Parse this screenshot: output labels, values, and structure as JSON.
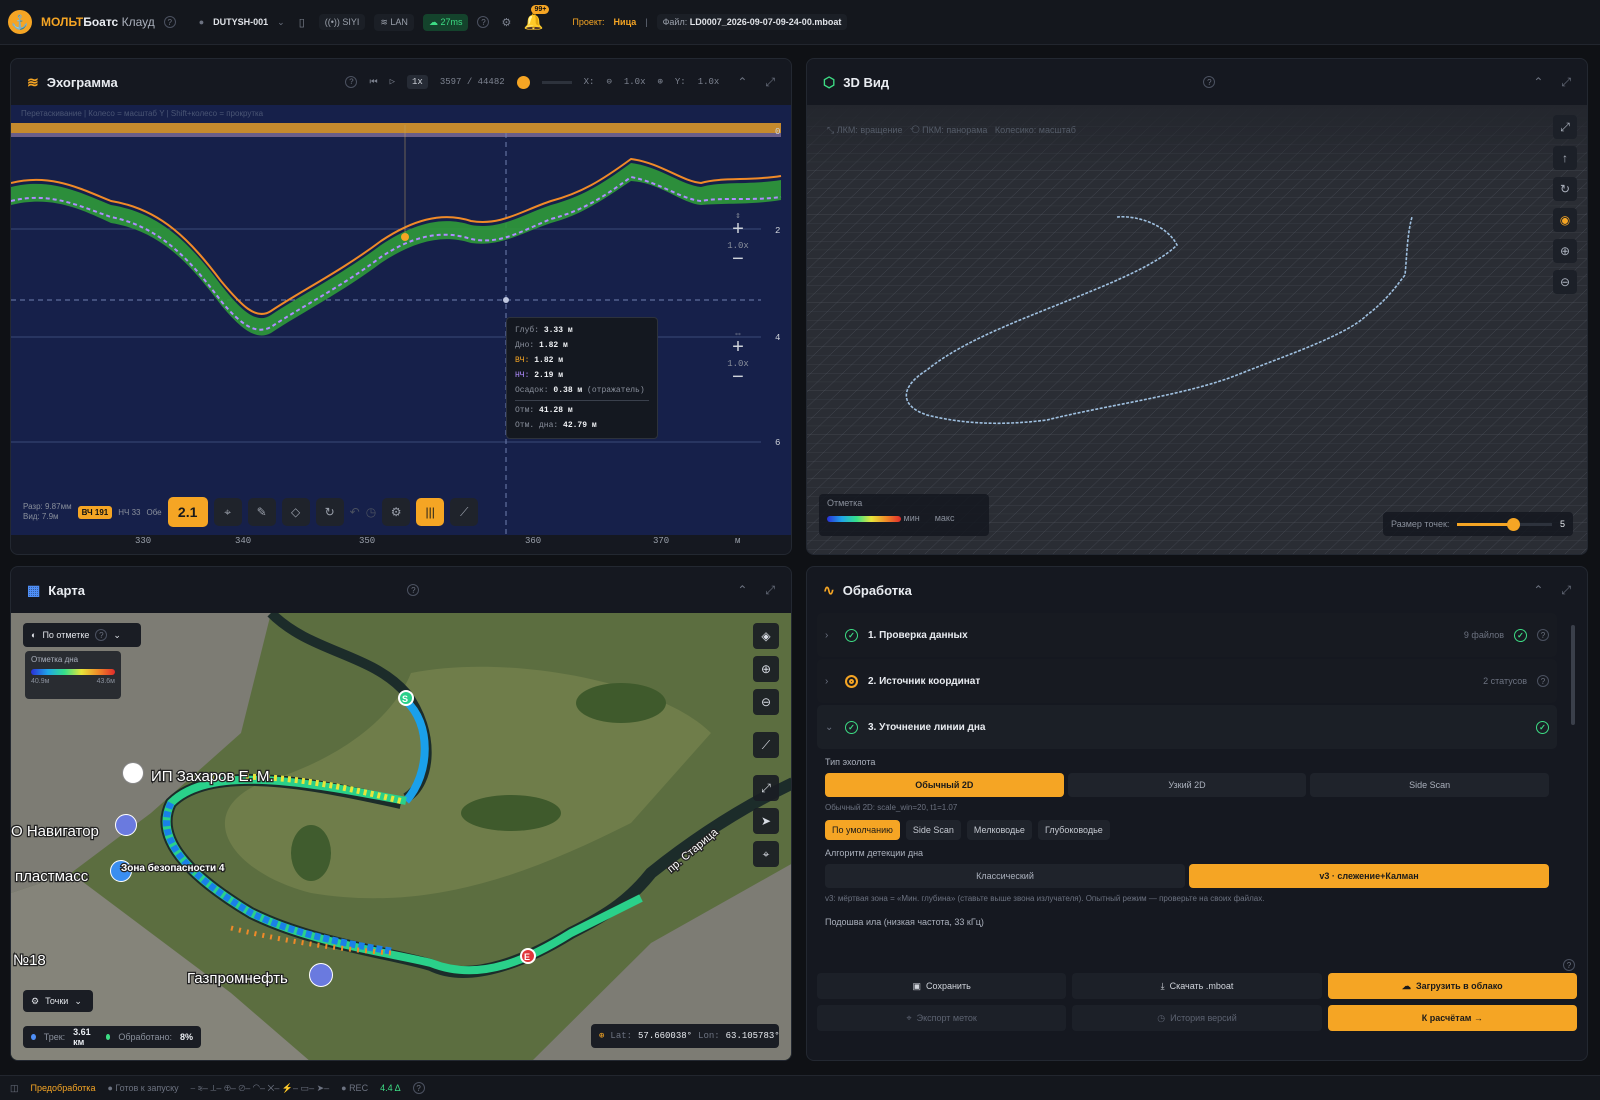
{
  "top": {
    "brand_a": "МОЛЬТ",
    "brand_b": "Боатс",
    "brand_c": "Клауд",
    "device": "DUTYSH-001",
    "sig": "SIYI",
    "lan": "LAN",
    "latency": "27ms",
    "notif": "99+",
    "project_label": "Проект:",
    "project": "Ница",
    "file_label": "Файл:",
    "file": "LD0007_2026-09-07-09-24-00.mboat"
  },
  "echo": {
    "title": "Эхограмма",
    "speed": "1x",
    "frame": "3597 / 44482",
    "xzoom_label": "X:",
    "xzoom": "1.0x",
    "yzoom_label": "Y:",
    "yzoom": "1.0x",
    "hint": "Перетаскивание | Колесо = масштаб Y | Shift+колесо = прокрутка",
    "depth_ticks": [
      "0",
      "2",
      "4",
      "6"
    ],
    "zoom1": "1.0x",
    "zoom2": "1.0x",
    "tooltip": {
      "depth_l": "Глуб:",
      "depth": "3.33 м",
      "bottom_l": "Дно:",
      "bottom": "1.82 м",
      "hf_l": "ВЧ:",
      "hf": "1.82 м",
      "lf_l": "НЧ:",
      "lf": "2.19 м",
      "draft_l": "Осадок:",
      "draft": "0.38 м",
      "draft_note": "(отражатель)",
      "elev_l": "Отм:",
      "elev": "41.28 м",
      "elev_b_l": "Отм. дна:",
      "elev_b": "42.79 м"
    },
    "res": "Разр: 9.87мм",
    "view": "Вид: 7.9м",
    "hf_btn": "ВЧ 191",
    "lf_btn": "НЧ 33",
    "both_btn": "Обе",
    "gain": "2.1",
    "x_ticks": [
      "330",
      "340",
      "350",
      "360",
      "370",
      "м"
    ]
  },
  "view3d": {
    "title": "3D Вид",
    "hint1": "ЛКМ: вращение",
    "hint2": "ПКМ: панорама",
    "hint3": "Колесико: масштаб",
    "legend_title": "Отметка",
    "legend_min": "мин",
    "legend_max": "макс",
    "ptsize_label": "Размер точек:",
    "ptsize": "5"
  },
  "map": {
    "title": "Карта",
    "mode": "По отметке",
    "legend_title": "Отметка дна",
    "legend_min": "40.9м",
    "legend_max": "43.6м",
    "points": "Точки",
    "track_label": "Трек:",
    "track": "3.61 км",
    "processed_label": "Обработано:",
    "processed": "8%",
    "lat_label": "Lat:",
    "lat": "57.660038°",
    "lon_label": "Lon:",
    "lon": "63.105783°",
    "labels": {
      "l1": "ИП Захаров Е. М.",
      "l2": "О Навигатор",
      "l3": "пластмасс",
      "l4": "Зона безопасности 4",
      "l5": "№18",
      "l6": "Газпромнефть",
      "l7": "пр. Старица"
    },
    "start": "S",
    "end": "E"
  },
  "proc": {
    "title": "Обработка",
    "steps": [
      {
        "label": "1. Проверка данных",
        "meta": "9 файлов"
      },
      {
        "label": "2. Источник координат",
        "meta": "2 статусов"
      },
      {
        "label": "3. Уточнение линии дна",
        "meta": ""
      }
    ],
    "sonar_type_label": "Тип эхолота",
    "sonar_types": [
      "Обычный 2D",
      "Узкий 2D",
      "Side Scan"
    ],
    "sonar_note": "Обычный 2D: scale_win=20, t1=1.07",
    "presets": [
      "По умолчанию",
      "Side Scan",
      "Мелководье",
      "Глубоководье"
    ],
    "algo_label": "Алгоритм детекции дна",
    "algos": [
      "Классический",
      "v3 · слежение+Калман"
    ],
    "algo_note": "v3: мёртвая зона = «Мин. глубина» (ставьте выше звона излучателя). Опытный режим — проверьте на своих файлах.",
    "cut_label": "Подошва ила (низкая частота, 33 кГц)",
    "save": "Сохранить",
    "download": "Скачать .mboat",
    "upload": "Загрузить в облако",
    "export": "Экспорт меток",
    "history": "История версий",
    "calc": "К расчётам →"
  },
  "status": {
    "mode": "Предобработка",
    "ready": "Готов к запуску",
    "rec": "REC",
    "val": "4.4 Δ"
  },
  "colors": {
    "accent": "#f5a524",
    "ok": "#3ddc84"
  }
}
